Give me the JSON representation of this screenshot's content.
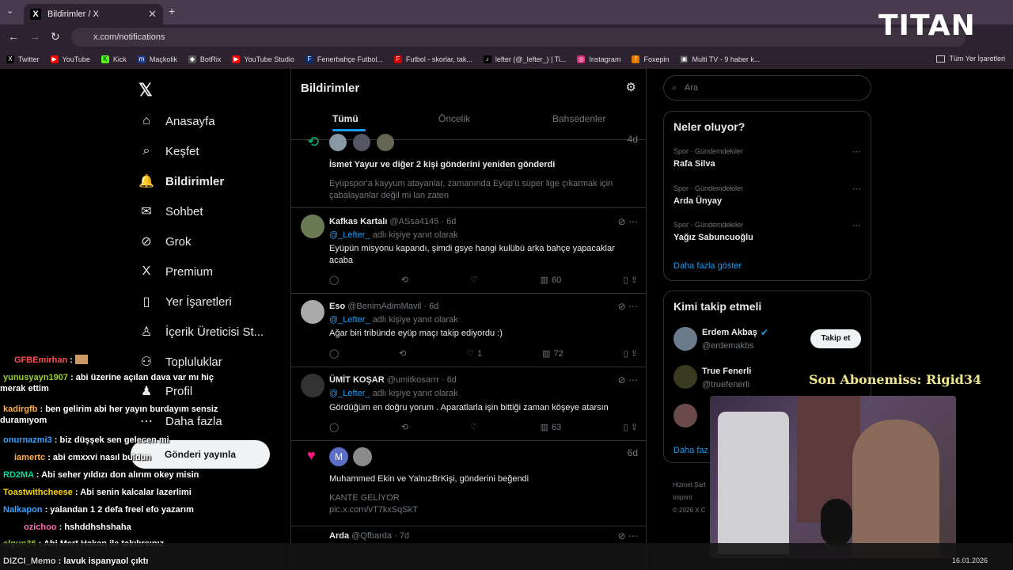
{
  "browser": {
    "tab_title": "Bildirimler / X",
    "url": "x.com/notifications",
    "bookmarks": [
      "Twitter",
      "YouTube",
      "Kick",
      "Maçkolik",
      "BotRix",
      "YouTube Studio",
      "Fenerbahçe Futbol...",
      "Futbol - skorlar, tak...",
      "lefter (@_lefter_) | Ti...",
      "Instagram",
      "Foxepin",
      "Multi TV - 9 haber k..."
    ],
    "bookmarks_folder": "Tüm Yer İşaretleri"
  },
  "nav": {
    "items": [
      "Anasayfa",
      "Keşfet",
      "Bildirimler",
      "Sohbet",
      "Grok",
      "Premium",
      "Yer İşaretleri",
      "İçerik Üreticisi St...",
      "Topluluklar",
      "Profil",
      "Daha fazla"
    ],
    "post_button": "Gönderi yayınla"
  },
  "feed": {
    "title": "Bildirimler",
    "tabs": [
      "Tümü",
      "Öncelik",
      "Bahsedenler"
    ],
    "posts": [
      {
        "kind": "repost",
        "time": "4d",
        "summary": "İsmet Yayur ve diğer 2 kişi gönderini yeniden gönderdi",
        "text": "Eyüpspor'a kayyum atayanlar, zamanında Eyüp'ü süper lige çıkarmak için çabalayanlar değil mi lan zaten"
      },
      {
        "kind": "reply",
        "name": "Kafkas Kartalı",
        "handle": "@ASsa4145 · 6d",
        "reply_to": "@_Lefter_",
        "reply_suffix": " adlı kişiye yanıt olarak",
        "text": "Eyüpün misyonu kapandı, şimdi gsye hangi kulübü arka bahçe yapacaklar acaba",
        "likes": "",
        "views": "60"
      },
      {
        "kind": "reply",
        "name": "Eso",
        "handle": "@BenimAdimMavil · 6d",
        "reply_to": "@_Lefter_",
        "reply_suffix": " adlı kişiye yanıt olarak",
        "text": "Ağar biri tribünde eyüp maçı takip ediyordu :)",
        "likes": "1",
        "views": "72"
      },
      {
        "kind": "reply",
        "name": "ÜMİT KOŞAR",
        "handle": "@umitkosarrr · 6d",
        "reply_to": "@_Lefter_",
        "reply_suffix": " adlı kişiye yanıt olarak",
        "text": "Gördüğüm en doğru yorum . Aparatlarla işin bittiği zaman köşeye atarsın",
        "likes": "",
        "views": "63"
      },
      {
        "kind": "like",
        "time": "6d",
        "summary": "Muhammed Ekin ve YalnızBrKişi, gönderini beğendi",
        "text": "KANTE GELİYOR",
        "link": "pic.x.com/vT7kxSqSkT"
      },
      {
        "kind": "reply",
        "name": "Arda",
        "handle": "@Qfbarda · 7d"
      }
    ]
  },
  "right": {
    "search_placeholder": "Ara",
    "trends_title": "Neler oluyor?",
    "trends": [
      {
        "cat": "Spor · Gündemdekiler",
        "name": "Rafa Silva"
      },
      {
        "cat": "Spor · Gündemdekiler",
        "name": "Arda Ünyay"
      },
      {
        "cat": "Spor · Gündemdekiler",
        "name": "Yağız Sabuncuoğlu"
      }
    ],
    "show_more": "Daha fazla göster",
    "who_title": "Kimi takip etmeli",
    "who": [
      {
        "name": "Erdem Akbaş",
        "handle": "@erdemakbs"
      },
      {
        "name": "True Fenerli",
        "handle": "@truefenerli"
      }
    ],
    "follow_label": "Takip et",
    "more_short": "Daha faz",
    "footer": [
      "Hizmet Şart",
      "Imprint",
      "© 2026 X C"
    ]
  },
  "overlay": {
    "brand": "TITAN",
    "sub_alert": "Son Abonemiss: Rigid34",
    "chat": [
      {
        "user": "GFBEmirhan",
        "color": "#ff4d4d",
        "msg": ""
      },
      {
        "user": "yunusyayn1907",
        "color": "#9acd32",
        "msg": "abi üzerine açılan dava var mı hiç merak ettim"
      },
      {
        "user": "kadirgfb",
        "color": "#ffb347",
        "msg": "ben gelirim abi her yayın burdayım sensiz duramıyom"
      },
      {
        "user": "onurnazmi3",
        "color": "#3aa0ff",
        "msg": "biz düşşek sen gelecen mi"
      },
      {
        "user": "iamertc",
        "color": "#ffb347",
        "msg": "abi cmxxvi nasıl buldun"
      },
      {
        "user": "RD2MA",
        "color": "#00e0a0",
        "msg": "Abi seher yıldızı don alırım okey misin"
      },
      {
        "user": "Toastwithcheese",
        "color": "#ffd700",
        "msg": "Abi senin kalcalar lazerlimi"
      },
      {
        "user": "Nalkapon",
        "color": "#3aa0ff",
        "msg": "yalandan 1 2 defa freel efo yazarım"
      },
      {
        "user": "ozichoo",
        "color": "#ff69b4",
        "msg": "hshddhshshaha"
      },
      {
        "user": "elgun36",
        "color": "#9acd32",
        "msg": "Abi Mert Hakan ila takılırsınız"
      },
      {
        "user": "DIZCI_Memo",
        "color": "#cfcfcf",
        "msg": "lavuk ispanyaol çıktı"
      }
    ],
    "taskbar_date": "16.01.2026"
  }
}
